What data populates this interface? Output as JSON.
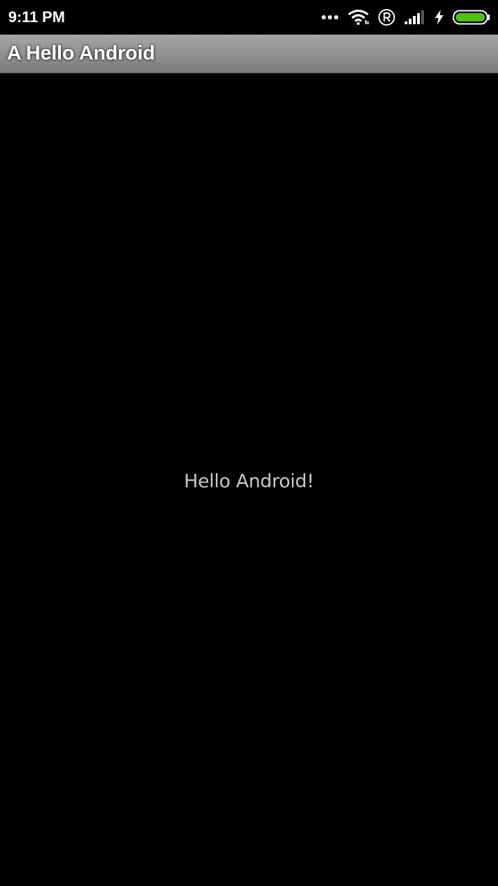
{
  "status_bar": {
    "time": "9:11 PM",
    "icons": [
      "more-dots-icon",
      "wifi-icon",
      "registered-icon",
      "signal-icon",
      "charging-bolt-icon",
      "battery-icon"
    ],
    "battery_color": "#4cc40f"
  },
  "title_bar": {
    "title": "A Hello Android"
  },
  "content": {
    "message": "Hello Android!"
  }
}
